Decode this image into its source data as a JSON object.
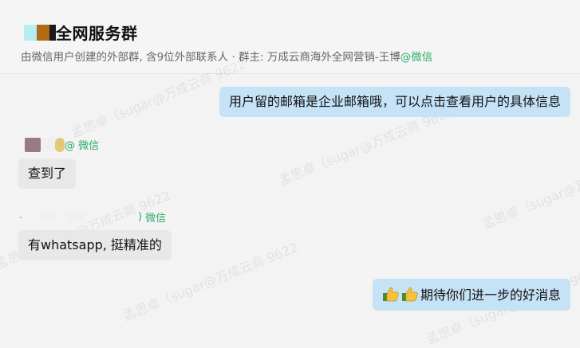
{
  "header": {
    "title": "全网服务群",
    "subtitle_main": "由微信用户创建的外部群, 含9位外部联系人 · 群主: 万成云商海外全网营销-王博",
    "subtitle_wx": "@微信",
    "avatar_colors": [
      "#b4eef2",
      "#b36a14",
      "#1a1a1a"
    ]
  },
  "watermark_text": "孟思卓（sugar@万成云商 9622",
  "messages": [
    {
      "direction": "out",
      "text": "用户留的邮箱是企业邮箱哦，可以点击查看用户的具体信息"
    },
    {
      "direction": "in",
      "sender_suffix": "@ 微信",
      "text": "查到了"
    },
    {
      "direction": "in",
      "sender_suffix": "微信",
      "text": "有whatsapp, 挺精准的"
    },
    {
      "direction": "out",
      "emoji": [
        "thumbs-up-icon",
        "thumbs-up-icon"
      ],
      "text": "期待你们进一步的好消息"
    }
  ],
  "colors": {
    "out_bubble": "#c6e2f7",
    "in_bubble": "#e8e8e8",
    "wechat_green": "#2aae67"
  }
}
